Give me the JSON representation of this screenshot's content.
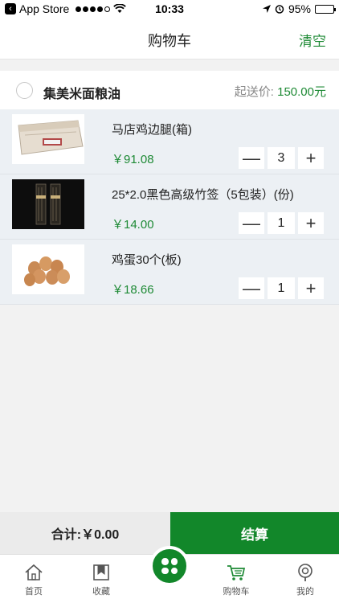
{
  "status_bar": {
    "carrier": "App Store",
    "time": "10:33",
    "battery": "95%"
  },
  "nav": {
    "title": "购物车",
    "clear_label": "清空"
  },
  "shop": {
    "name": "集美米面粮油",
    "min_order_label": "起送价: ",
    "min_order_value": "150.00元"
  },
  "items": [
    {
      "name": "马店鸡边腿(箱)",
      "price": "￥91.08",
      "qty": "3"
    },
    {
      "name": "25*2.0黑色高级竹签（5包装）(份)",
      "price": "￥14.00",
      "qty": "1"
    },
    {
      "name": "鸡蛋30个(板)",
      "price": "￥18.66",
      "qty": "1"
    }
  ],
  "stepper": {
    "minus": "—",
    "plus": "+"
  },
  "summary": {
    "total_label": "合计: ",
    "total_value": "￥0.00",
    "checkout_label": "结算"
  },
  "tabs": [
    {
      "label": "首页",
      "icon": "home-icon"
    },
    {
      "label": "收藏",
      "icon": "bookmark-icon"
    },
    {
      "label": "",
      "icon": "grid-icon"
    },
    {
      "label": "购物车",
      "icon": "cart-icon"
    },
    {
      "label": "我的",
      "icon": "profile-icon"
    }
  ],
  "colors": {
    "accent": "#1e8a35",
    "checkout_bg": "#12872a",
    "item_bg": "#ecf0f4"
  }
}
